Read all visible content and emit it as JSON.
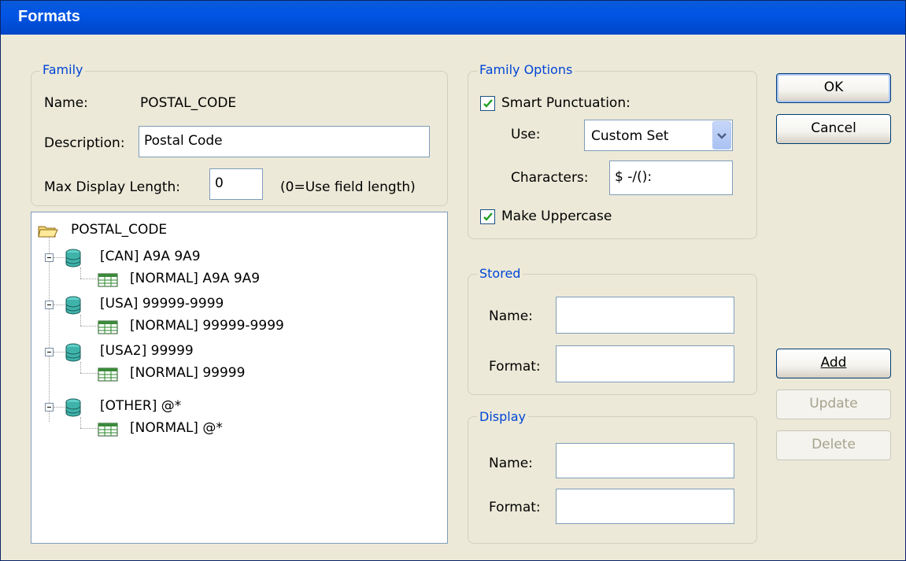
{
  "window": {
    "title": "Formats"
  },
  "family": {
    "legend": "Family",
    "name_label": "Name:",
    "name_value": "POSTAL_CODE",
    "description_label": "Description:",
    "description_value": "Postal Code",
    "max_length_label": "Max Display Length:",
    "max_length_value": "0",
    "max_length_hint": "(0=Use field length)"
  },
  "tree": {
    "root": "POSTAL_CODE",
    "groups": [
      {
        "label": "[CAN] A9A 9A9",
        "child": "[NORMAL] A9A 9A9"
      },
      {
        "label": "[USA] 99999-9999",
        "child": "[NORMAL] 99999-9999"
      },
      {
        "label": "[USA2] 99999",
        "child": "[NORMAL] 99999"
      },
      {
        "label": "[OTHER] @*",
        "child": "[NORMAL] @*"
      }
    ]
  },
  "family_options": {
    "legend": "Family Options",
    "smart_punctuation_label": "Smart Punctuation:",
    "smart_punctuation_checked": true,
    "use_label": "Use:",
    "use_value": "Custom Set",
    "characters_label": "Characters:",
    "characters_value": "$ -/():",
    "make_uppercase_label": "Make Uppercase",
    "make_uppercase_checked": true
  },
  "stored": {
    "legend": "Stored",
    "name_label": "Name:",
    "name_value": "",
    "format_label": "Format:",
    "format_value": ""
  },
  "display": {
    "legend": "Display",
    "name_label": "Name:",
    "name_value": "",
    "format_label": "Format:",
    "format_value": ""
  },
  "buttons": {
    "ok": "OK",
    "cancel": "Cancel",
    "add": "Add",
    "update": "Update",
    "delete": "Delete"
  },
  "colors": {
    "titlebar": "#0055e5",
    "legend_text": "#0046d5",
    "dialog_bg": "#ece9d8",
    "check_mark": "#21a121"
  }
}
